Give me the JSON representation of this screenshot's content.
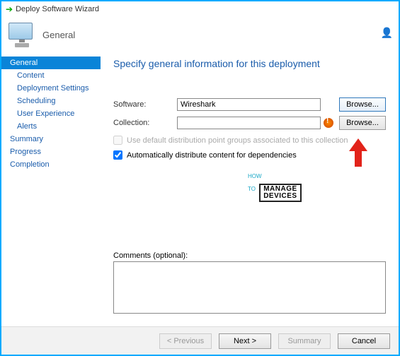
{
  "window": {
    "title": "Deploy Software Wizard"
  },
  "header": {
    "section": "General"
  },
  "sidebar": {
    "items": [
      {
        "label": "General",
        "selected": true,
        "child": false
      },
      {
        "label": "Content",
        "selected": false,
        "child": true
      },
      {
        "label": "Deployment Settings",
        "selected": false,
        "child": true
      },
      {
        "label": "Scheduling",
        "selected": false,
        "child": true
      },
      {
        "label": "User Experience",
        "selected": false,
        "child": true
      },
      {
        "label": "Alerts",
        "selected": false,
        "child": true
      },
      {
        "label": "Summary",
        "selected": false,
        "child": false
      },
      {
        "label": "Progress",
        "selected": false,
        "child": false
      },
      {
        "label": "Completion",
        "selected": false,
        "child": false
      }
    ]
  },
  "main": {
    "title": "Specify general information for this deployment",
    "software_label": "Software:",
    "software_value": "Wireshark",
    "collection_label": "Collection:",
    "collection_value": "",
    "browse_label": "Browse...",
    "default_dist_label": "Use default distribution point groups associated to this collection",
    "auto_dist_label": "Automatically distribute content for dependencies",
    "comments_label": "Comments (optional):",
    "comments_value": ""
  },
  "watermark": {
    "how": "HOW",
    "to": "TO",
    "line1": "MANAGE",
    "line2": "DEVICES"
  },
  "footer": {
    "previous": "< Previous",
    "next": "Next >",
    "summary": "Summary",
    "cancel": "Cancel"
  }
}
